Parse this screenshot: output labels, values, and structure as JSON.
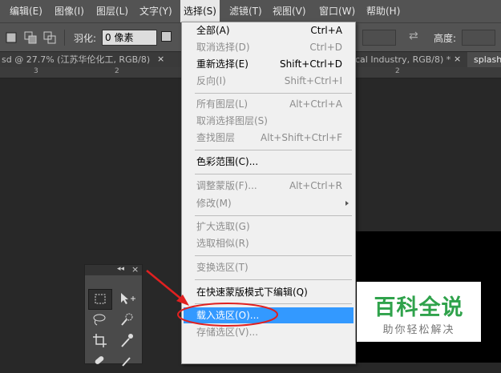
{
  "menubar": {
    "items": [
      "编辑(E)",
      "图像(I)",
      "图层(L)",
      "文字(Y)",
      "选择(S)",
      "滤镜(T)",
      "视图(V)",
      "窗口(W)",
      "帮助(H)"
    ]
  },
  "options": {
    "feather_label": "羽化:",
    "feather_value": "0 像素",
    "height_label": "高度:"
  },
  "tabs": [
    {
      "label": "sd @ 27.7% (江苏华伦化工, RGB/8)",
      "close": "×"
    },
    {
      "label": "cal Industry, RGB/8) *",
      "close": "×"
    },
    {
      "label": "splash"
    }
  ],
  "ruler": {
    "marks": [
      "3",
      "2",
      "2"
    ]
  },
  "dropdown": {
    "items": [
      {
        "label": "全部(A)",
        "shortcut": "Ctrl+A",
        "enabled": true
      },
      {
        "label": "取消选择(D)",
        "shortcut": "Ctrl+D",
        "enabled": false
      },
      {
        "label": "重新选择(E)",
        "shortcut": "Shift+Ctrl+D",
        "enabled": true
      },
      {
        "label": "反向(I)",
        "shortcut": "Shift+Ctrl+I",
        "enabled": false
      },
      {
        "label": "所有图层(L)",
        "shortcut": "Alt+Ctrl+A",
        "enabled": false
      },
      {
        "label": "取消选择图层(S)",
        "shortcut": "",
        "enabled": false
      },
      {
        "label": "查找图层",
        "shortcut": "Alt+Shift+Ctrl+F",
        "enabled": false
      },
      {
        "label": "色彩范围(C)...",
        "shortcut": "",
        "enabled": true
      },
      {
        "label": "调整蒙版(F)...",
        "shortcut": "Alt+Ctrl+R",
        "enabled": false
      },
      {
        "label": "修改(M)",
        "shortcut": "",
        "enabled": false
      },
      {
        "label": "扩大选取(G)",
        "shortcut": "",
        "enabled": false
      },
      {
        "label": "选取相似(R)",
        "shortcut": "",
        "enabled": false
      },
      {
        "label": "变换选区(T)",
        "shortcut": "",
        "enabled": false
      },
      {
        "label": "在快速蒙版模式下编辑(Q)",
        "shortcut": "",
        "enabled": true
      },
      {
        "label": "载入选区(O)...",
        "shortcut": "",
        "enabled": true,
        "highlighted": true
      },
      {
        "label": "存储选区(V)...",
        "shortcut": "",
        "enabled": false
      }
    ]
  },
  "tools_panel": {
    "collapse": "◂◂",
    "close": "×"
  },
  "watermark": {
    "title": "百科全说",
    "subtitle": "助你轻松解决"
  },
  "colors": {
    "highlight": "#3399ff",
    "annotation": "#e02020",
    "watermark_green": "#2fa24b"
  }
}
